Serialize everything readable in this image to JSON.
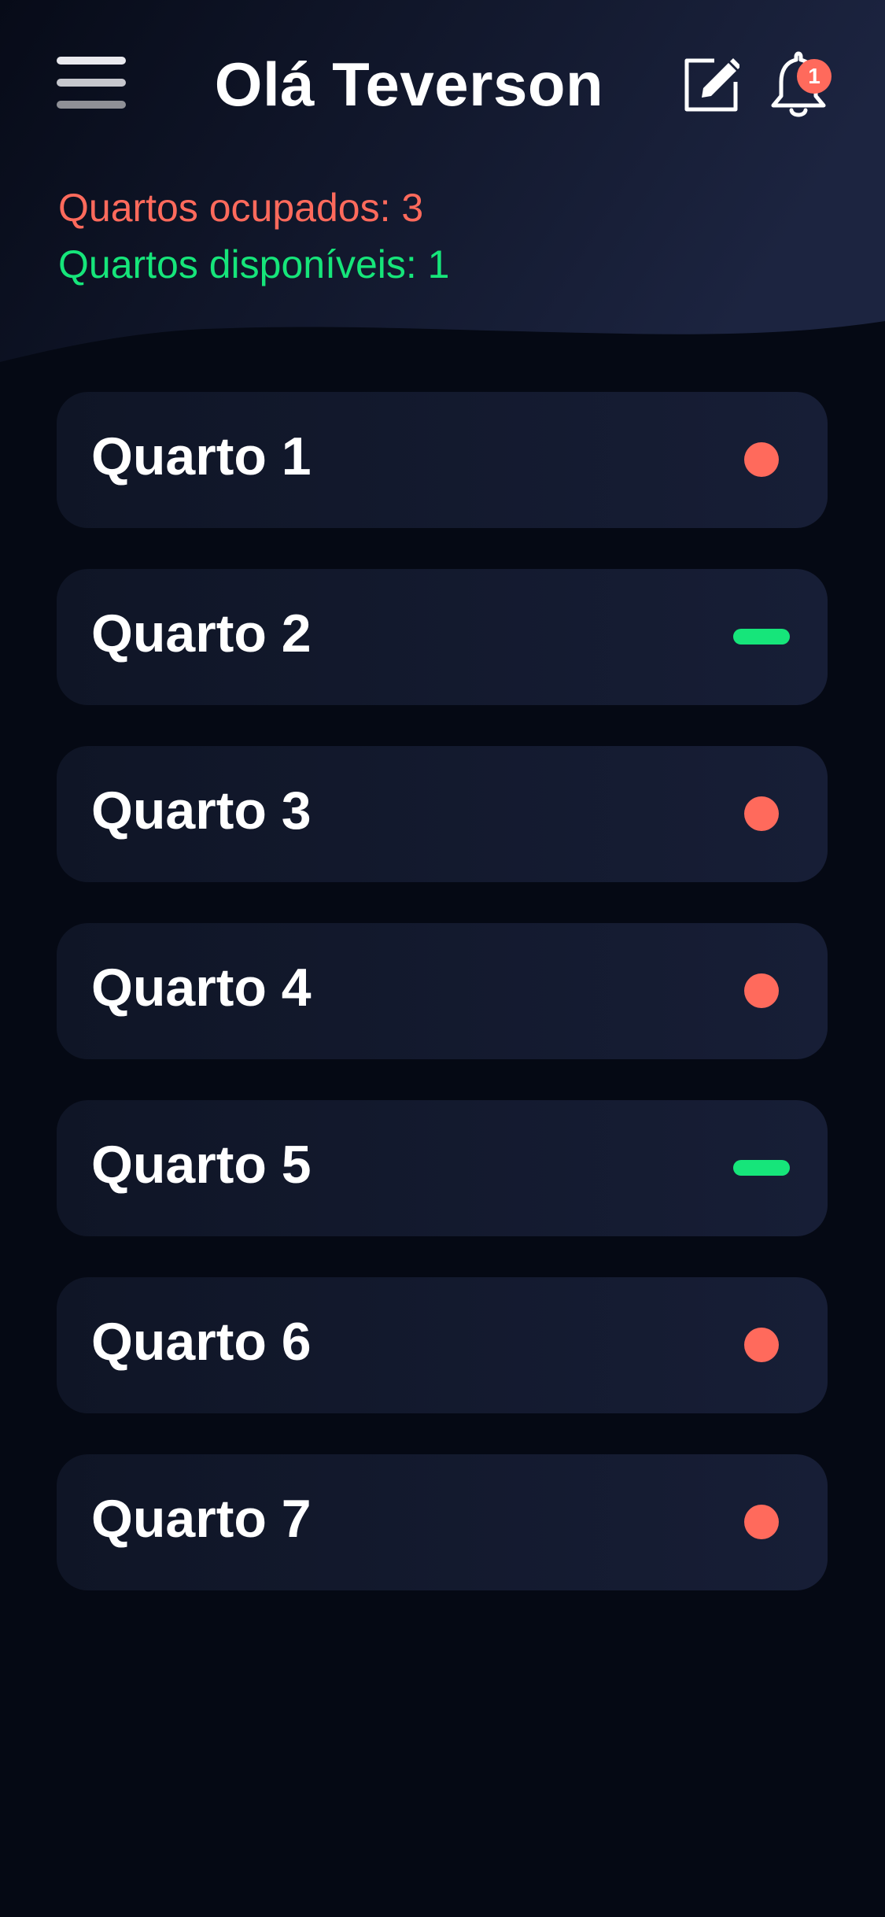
{
  "header": {
    "greeting": "Olá Teverson",
    "menu_icon": "hamburger-menu-icon",
    "edit_icon": "edit-note-icon",
    "notification_icon": "bell-icon",
    "notification_count": "1"
  },
  "summary": {
    "occupied": "Quartos ocupados: 3",
    "available": "Quartos disponíveis: 1"
  },
  "colors": {
    "background": "#050914",
    "card": "#141b30",
    "occupied": "#ff6a5c",
    "available": "#16e57a"
  },
  "rooms": [
    {
      "name": "Quarto 1",
      "status": "occupied"
    },
    {
      "name": "Quarto 2",
      "status": "available"
    },
    {
      "name": "Quarto 3",
      "status": "occupied"
    },
    {
      "name": "Quarto 4",
      "status": "occupied"
    },
    {
      "name": "Quarto 5",
      "status": "available"
    },
    {
      "name": "Quarto 6",
      "status": "occupied"
    },
    {
      "name": "Quarto 7",
      "status": "occupied"
    }
  ]
}
